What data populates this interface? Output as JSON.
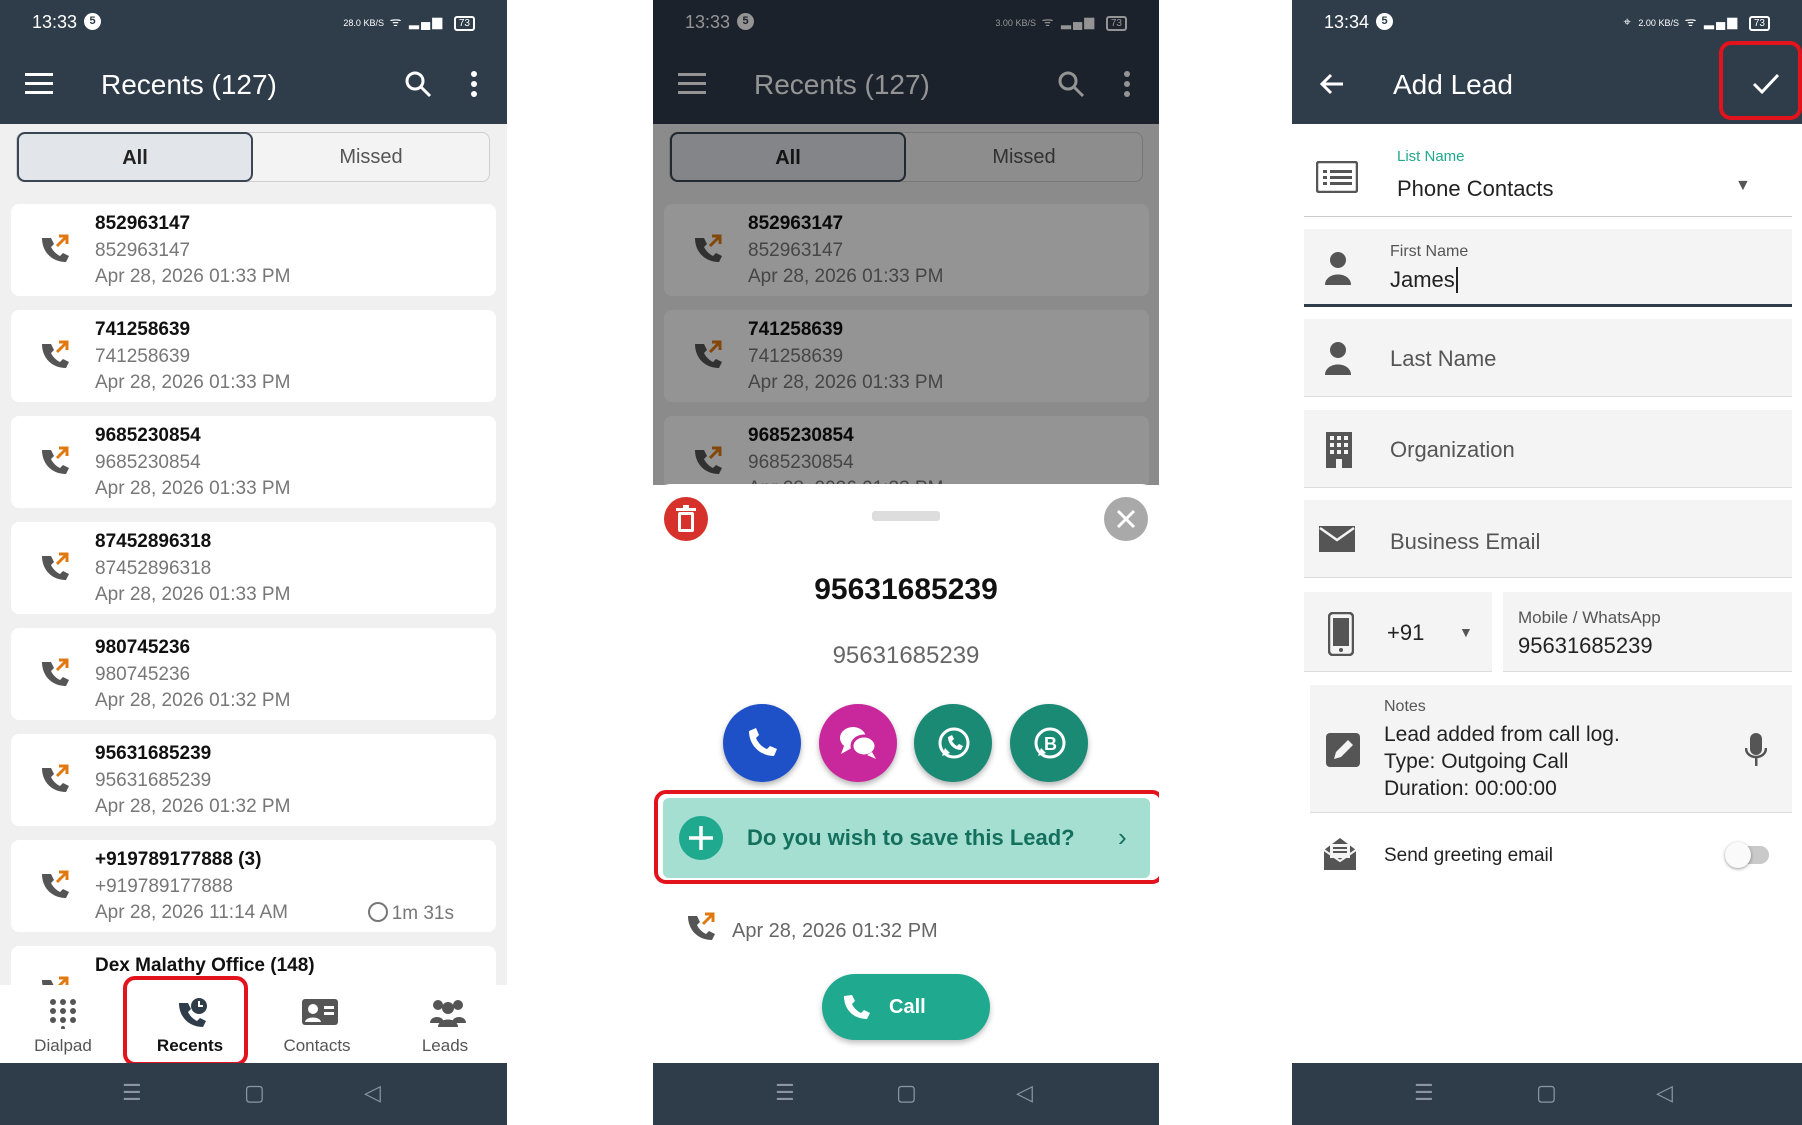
{
  "colors": {
    "appbar": "#2f3c4a",
    "teal": "#1fa98f",
    "red_highlight": "#e3131d",
    "call_blue": "#1e50c8",
    "chat_pink": "#c8289b",
    "whatsapp": "#1a8a74"
  },
  "screen1": {
    "status": {
      "time": "13:33",
      "badge": "5",
      "net": "28.0 KB/S",
      "battery": "73"
    },
    "title": "Recents (127)",
    "tabs": [
      "All",
      "Missed"
    ],
    "calls": [
      {
        "name": "852963147",
        "number": "852963147",
        "date": "Apr 28, 2026 01:33 PM",
        "duration": ""
      },
      {
        "name": "741258639",
        "number": "741258639",
        "date": "Apr 28, 2026 01:33 PM",
        "duration": ""
      },
      {
        "name": "9685230854",
        "number": "9685230854",
        "date": "Apr 28, 2026 01:33 PM",
        "duration": ""
      },
      {
        "name": "87452896318",
        "number": "87452896318",
        "date": "Apr 28, 2026 01:33 PM",
        "duration": ""
      },
      {
        "name": "980745236",
        "number": "980745236",
        "date": "Apr 28, 2026 01:32 PM",
        "duration": ""
      },
      {
        "name": "95631685239",
        "number": "95631685239",
        "date": "Apr 28, 2026 01:32 PM",
        "duration": ""
      },
      {
        "name": "+919789177888 (3)",
        "number": "+919789177888",
        "date": "Apr 28, 2026 11:14 AM",
        "duration": "1m 31s"
      },
      {
        "name": "Dex Malathy Office (148)",
        "number": "",
        "date": "",
        "duration": ""
      }
    ],
    "bottom_nav": [
      "Dialpad",
      "Recents",
      "Contacts",
      "Leads"
    ]
  },
  "screen2": {
    "status": {
      "time": "13:33",
      "badge": "5",
      "net": "3.00 KB/S",
      "battery": "73"
    },
    "title": "Recents (127)",
    "tabs": [
      "All",
      "Missed"
    ],
    "calls": [
      {
        "name": "852963147",
        "number": "852963147",
        "date": "Apr 28, 2026 01:33 PM"
      },
      {
        "name": "741258639",
        "number": "741258639",
        "date": "Apr 28, 2026 01:33 PM"
      },
      {
        "name": "9685230854",
        "number": "9685230854",
        "date": "Apr 28, 2026 01:33 PM"
      }
    ],
    "sheet": {
      "title": "95631685239",
      "subtitle": "95631685239",
      "save_prompt": "Do you wish to save this Lead?",
      "call_date": "Apr 28, 2026 01:32 PM",
      "call_button": "Call"
    }
  },
  "screen3": {
    "status": {
      "time": "13:34",
      "badge": "5",
      "net": "2.00 KB/S",
      "battery": "73"
    },
    "title": "Add Lead",
    "list_name_label": "List Name",
    "list_name_value": "Phone Contacts",
    "first_name_label": "First Name",
    "first_name_value": "James",
    "last_name_placeholder": "Last Name",
    "organization_placeholder": "Organization",
    "business_email_placeholder": "Business Email",
    "country_code": "+91",
    "mobile_label": "Mobile / WhatsApp",
    "mobile_value": "95631685239",
    "notes_label": "Notes",
    "notes_lines": [
      "Lead added from call log.",
      "Type: Outgoing Call",
      "Duration: 00:00:00"
    ],
    "greeting_label": "Send greeting email",
    "greeting_enabled": false
  }
}
